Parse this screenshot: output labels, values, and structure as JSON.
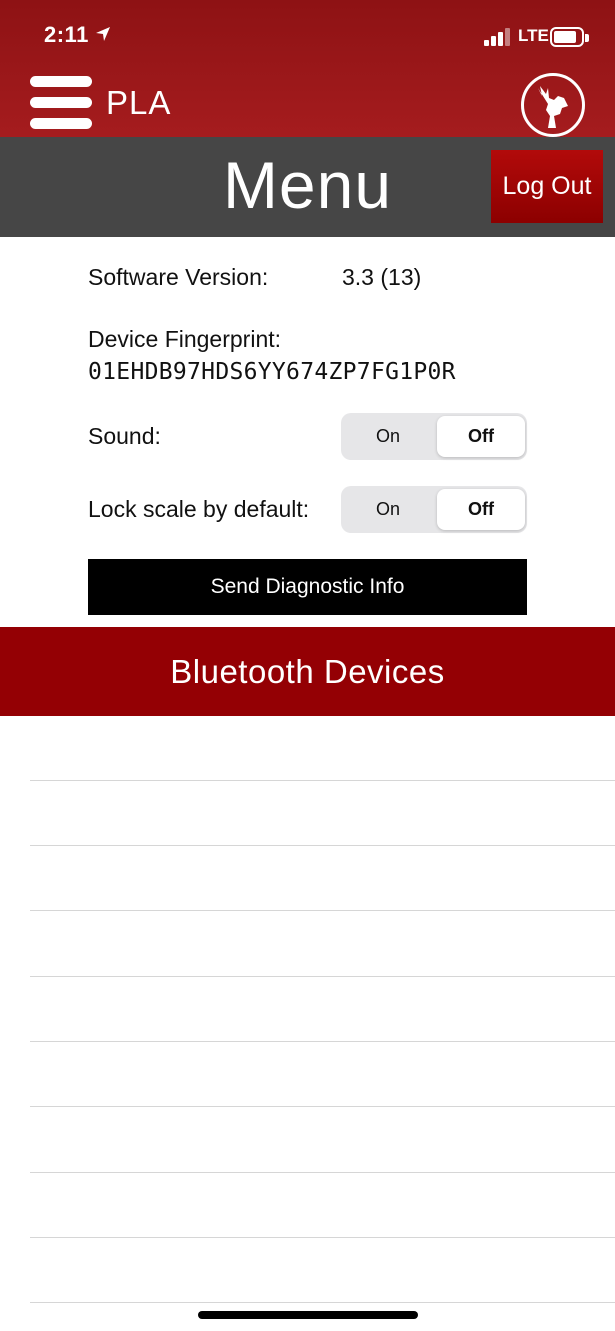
{
  "status_bar": {
    "time": "2:11",
    "network": "LTE",
    "icons": [
      "location-icon",
      "signal-icon",
      "battery-icon"
    ]
  },
  "nav": {
    "app_title": "PLA",
    "menu_icon": "hamburger-icon",
    "logo_icon": "deer-logo-icon"
  },
  "header": {
    "title": "Menu",
    "logout_label": "Log Out"
  },
  "settings": {
    "software_version_label": "Software Version:",
    "software_version_value": "3.3 (13)",
    "fingerprint_label": "Device Fingerprint:",
    "fingerprint_value": "01EHDB97HDS6YY674ZP7FG1P0R",
    "sound_label": "Sound:",
    "sound_on": "On",
    "sound_off": "Off",
    "sound_selected": "Off",
    "lock_label": "Lock scale by default:",
    "lock_on": "On",
    "lock_off": "Off",
    "lock_selected": "Off",
    "diagnostic_button": "Send Diagnostic Info"
  },
  "bluetooth": {
    "title": "Bluetooth Devices",
    "devices": [
      "",
      "",
      "",
      "",
      "",
      "",
      "",
      "",
      ""
    ]
  },
  "colors": {
    "nav_red": "#9b1a1c",
    "header_gray": "#464646",
    "logout_red": "#a30505",
    "bt_red": "#940004"
  }
}
